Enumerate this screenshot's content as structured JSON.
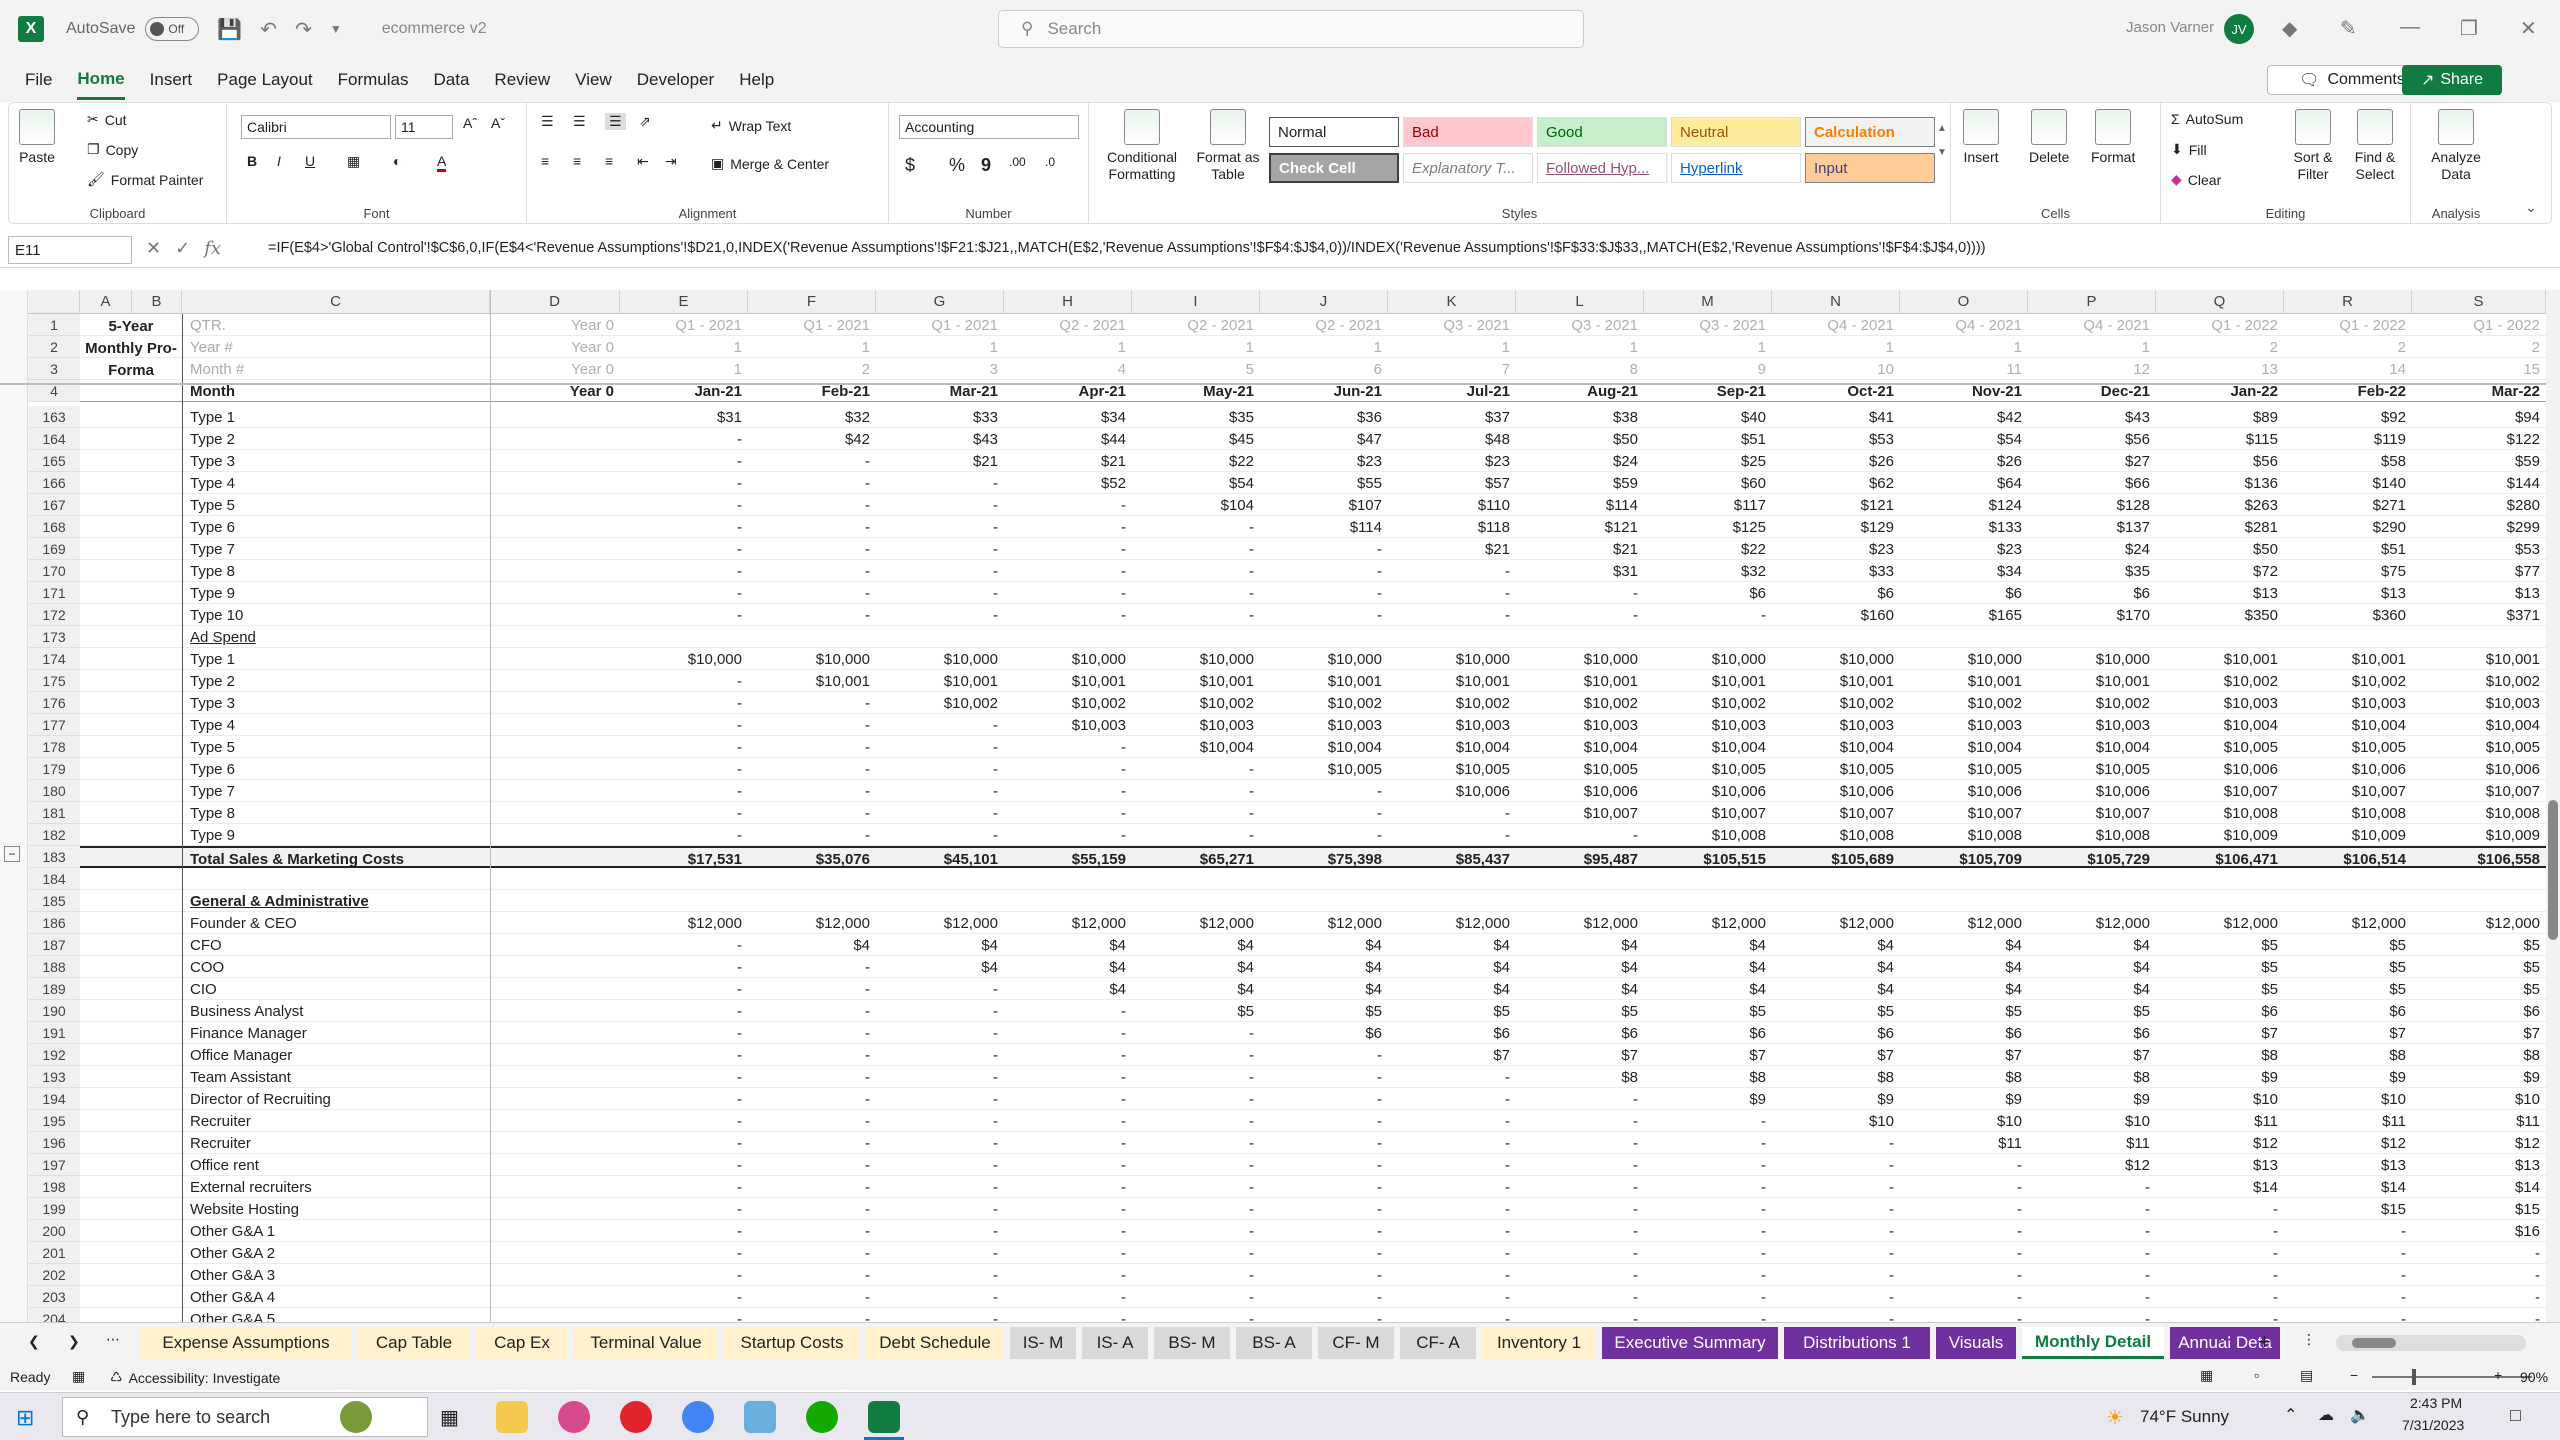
{
  "titlebar": {
    "autosave": "AutoSave",
    "toggle": "Off",
    "doc": "ecommerce v2",
    "search": "Search",
    "user": "Jason Varner",
    "initials": "JV"
  },
  "menu": [
    "File",
    "Home",
    "Insert",
    "Page Layout",
    "Formulas",
    "Data",
    "Review",
    "View",
    "Developer",
    "Help"
  ],
  "menu_active": "Home",
  "buttons": {
    "comments": "Comments",
    "share": "Share"
  },
  "ribbon": {
    "clipboard": {
      "label": "Clipboard",
      "paste": "Paste",
      "cut": "Cut",
      "copy": "Copy",
      "format_painter": "Format Painter"
    },
    "font": {
      "label": "Font",
      "name": "Calibri",
      "size": "11"
    },
    "alignment": {
      "label": "Alignment",
      "wrap": "Wrap Text",
      "merge": "Merge & Center"
    },
    "number": {
      "label": "Number",
      "format": "Accounting",
      "currency": "$",
      "percent": "%",
      "comma": "9"
    },
    "styles": {
      "label": "Styles",
      "conditional": "Conditional Formatting",
      "format_table": "Format as Table",
      "normal": "Normal",
      "bad": "Bad",
      "good": "Good",
      "neutral": "Neutral",
      "calculation": "Calculation",
      "check_cell": "Check Cell",
      "explanatory": "Explanatory T...",
      "followed": "Followed Hyp...",
      "hyperlink": "Hyperlink",
      "input": "Input"
    },
    "cells": {
      "label": "Cells",
      "insert": "Insert",
      "delete": "Delete",
      "format": "Format"
    },
    "editing": {
      "label": "Editing",
      "autosum": "AutoSum",
      "fill": "Fill",
      "clear": "Clear",
      "sort": "Sort & Filter",
      "find": "Find & Select"
    },
    "analysis": {
      "label": "Analysis",
      "analyze": "Analyze Data"
    }
  },
  "namebox": "E11",
  "formula": "=IF(E$4>'Global Control'!$C$6,0,IF(E$4<'Revenue Assumptions'!$D21,0,INDEX('Revenue Assumptions'!$F21:$J21,,MATCH(E$2,'Revenue Assumptions'!$F$4:$J$4,0))/INDEX('Revenue Assumptions'!$F$33:$J$33,,MATCH(E$2,'Revenue Assumptions'!$F$4:$J$4,0))))",
  "columns": [
    "A",
    "B",
    "C",
    "D",
    "E",
    "F",
    "G",
    "H",
    "I",
    "J",
    "K",
    "L",
    "M",
    "N",
    "O",
    "P",
    "Q",
    "R",
    "S"
  ],
  "side_title": [
    "5-Year",
    "Monthly Pro-",
    "Forma"
  ],
  "header_rows": [
    {
      "row": "1",
      "label": "QTR.",
      "d": "Year 0",
      "vals": [
        "Q1 - 2021",
        "Q1 - 2021",
        "Q1 - 2021",
        "Q2 - 2021",
        "Q2 - 2021",
        "Q2 - 2021",
        "Q3 - 2021",
        "Q3 - 2021",
        "Q3 - 2021",
        "Q4 - 2021",
        "Q4 - 2021",
        "Q4 - 2021",
        "Q1 - 2022",
        "Q1 - 2022",
        "Q1 - 2022"
      ]
    },
    {
      "row": "2",
      "label": "Year #",
      "d": "Year 0",
      "vals": [
        "1",
        "1",
        "1",
        "1",
        "1",
        "1",
        "1",
        "1",
        "1",
        "1",
        "1",
        "1",
        "2",
        "2",
        "2"
      ]
    },
    {
      "row": "3",
      "label": "Month #",
      "d": "Year 0",
      "vals": [
        "1",
        "2",
        "3",
        "4",
        "5",
        "6",
        "7",
        "8",
        "9",
        "10",
        "11",
        "12",
        "13",
        "14",
        "15"
      ]
    },
    {
      "row": "4",
      "label": "Month",
      "d": "Year 0",
      "vals": [
        "Jan-21",
        "Feb-21",
        "Mar-21",
        "Apr-21",
        "May-21",
        "Jun-21",
        "Jul-21",
        "Aug-21",
        "Sep-21",
        "Oct-21",
        "Nov-21",
        "Dec-21",
        "Jan-22",
        "Feb-22",
        "Mar-22"
      ]
    }
  ],
  "rows": [
    {
      "row": "163",
      "label": "Type 1",
      "vals": [
        "$31",
        "$32",
        "$33",
        "$34",
        "$35",
        "$36",
        "$37",
        "$38",
        "$40",
        "$41",
        "$42",
        "$43",
        "$89",
        "$92",
        "$94"
      ]
    },
    {
      "row": "164",
      "label": "Type 2",
      "vals": [
        "-",
        "$42",
        "$43",
        "$44",
        "$45",
        "$47",
        "$48",
        "$50",
        "$51",
        "$53",
        "$54",
        "$56",
        "$115",
        "$119",
        "$122"
      ]
    },
    {
      "row": "165",
      "label": "Type 3",
      "vals": [
        "-",
        "-",
        "$21",
        "$21",
        "$22",
        "$23",
        "$23",
        "$24",
        "$25",
        "$26",
        "$26",
        "$27",
        "$56",
        "$58",
        "$59"
      ]
    },
    {
      "row": "166",
      "label": "Type 4",
      "vals": [
        "-",
        "-",
        "-",
        "$52",
        "$54",
        "$55",
        "$57",
        "$59",
        "$60",
        "$62",
        "$64",
        "$66",
        "$136",
        "$140",
        "$144"
      ]
    },
    {
      "row": "167",
      "label": "Type 5",
      "vals": [
        "-",
        "-",
        "-",
        "-",
        "$104",
        "$107",
        "$110",
        "$114",
        "$117",
        "$121",
        "$124",
        "$128",
        "$263",
        "$271",
        "$280"
      ]
    },
    {
      "row": "168",
      "label": "Type 6",
      "vals": [
        "-",
        "-",
        "-",
        "-",
        "-",
        "$114",
        "$118",
        "$121",
        "$125",
        "$129",
        "$133",
        "$137",
        "$281",
        "$290",
        "$299"
      ]
    },
    {
      "row": "169",
      "label": "Type 7",
      "vals": [
        "-",
        "-",
        "-",
        "-",
        "-",
        "-",
        "$21",
        "$21",
        "$22",
        "$23",
        "$23",
        "$24",
        "$50",
        "$51",
        "$53"
      ]
    },
    {
      "row": "170",
      "label": "Type 8",
      "vals": [
        "-",
        "-",
        "-",
        "-",
        "-",
        "-",
        "-",
        "$31",
        "$32",
        "$33",
        "$34",
        "$35",
        "$72",
        "$75",
        "$77"
      ]
    },
    {
      "row": "171",
      "label": "Type 9",
      "vals": [
        "-",
        "-",
        "-",
        "-",
        "-",
        "-",
        "-",
        "-",
        "$6",
        "$6",
        "$6",
        "$6",
        "$13",
        "$13",
        "$13"
      ]
    },
    {
      "row": "172",
      "label": "Type 10",
      "vals": [
        "-",
        "-",
        "-",
        "-",
        "-",
        "-",
        "-",
        "-",
        "-",
        "$160",
        "$165",
        "$170",
        "$350",
        "$360",
        "$371"
      ]
    },
    {
      "row": "173",
      "label": "Ad Spend",
      "style": "ulp",
      "vals": [
        "",
        "",
        "",
        "",
        "",
        "",
        "",
        "",
        "",
        "",
        "",
        "",
        "",
        "",
        ""
      ]
    },
    {
      "row": "174",
      "label": "Type 1",
      "vals": [
        "$10,000",
        "$10,000",
        "$10,000",
        "$10,000",
        "$10,000",
        "$10,000",
        "$10,000",
        "$10,000",
        "$10,000",
        "$10,000",
        "$10,000",
        "$10,000",
        "$10,001",
        "$10,001",
        "$10,001"
      ]
    },
    {
      "row": "175",
      "label": "Type 2",
      "vals": [
        "-",
        "$10,001",
        "$10,001",
        "$10,001",
        "$10,001",
        "$10,001",
        "$10,001",
        "$10,001",
        "$10,001",
        "$10,001",
        "$10,001",
        "$10,001",
        "$10,002",
        "$10,002",
        "$10,002"
      ]
    },
    {
      "row": "176",
      "label": "Type 3",
      "vals": [
        "-",
        "-",
        "$10,002",
        "$10,002",
        "$10,002",
        "$10,002",
        "$10,002",
        "$10,002",
        "$10,002",
        "$10,002",
        "$10,002",
        "$10,002",
        "$10,003",
        "$10,003",
        "$10,003"
      ]
    },
    {
      "row": "177",
      "label": "Type 4",
      "vals": [
        "-",
        "-",
        "-",
        "$10,003",
        "$10,003",
        "$10,003",
        "$10,003",
        "$10,003",
        "$10,003",
        "$10,003",
        "$10,003",
        "$10,003",
        "$10,004",
        "$10,004",
        "$10,004"
      ]
    },
    {
      "row": "178",
      "label": "Type 5",
      "vals": [
        "-",
        "-",
        "-",
        "-",
        "$10,004",
        "$10,004",
        "$10,004",
        "$10,004",
        "$10,004",
        "$10,004",
        "$10,004",
        "$10,004",
        "$10,005",
        "$10,005",
        "$10,005"
      ]
    },
    {
      "row": "179",
      "label": "Type 6",
      "vals": [
        "-",
        "-",
        "-",
        "-",
        "-",
        "$10,005",
        "$10,005",
        "$10,005",
        "$10,005",
        "$10,005",
        "$10,005",
        "$10,005",
        "$10,006",
        "$10,006",
        "$10,006"
      ]
    },
    {
      "row": "180",
      "label": "Type 7",
      "vals": [
        "-",
        "-",
        "-",
        "-",
        "-",
        "-",
        "$10,006",
        "$10,006",
        "$10,006",
        "$10,006",
        "$10,006",
        "$10,006",
        "$10,007",
        "$10,007",
        "$10,007"
      ]
    },
    {
      "row": "181",
      "label": "Type 8",
      "vals": [
        "-",
        "-",
        "-",
        "-",
        "-",
        "-",
        "-",
        "$10,007",
        "$10,007",
        "$10,007",
        "$10,007",
        "$10,007",
        "$10,008",
        "$10,008",
        "$10,008"
      ]
    },
    {
      "row": "182",
      "label": "Type 9",
      "vals": [
        "-",
        "-",
        "-",
        "-",
        "-",
        "-",
        "-",
        "-",
        "$10,008",
        "$10,008",
        "$10,008",
        "$10,008",
        "$10,009",
        "$10,009",
        "$10,009"
      ]
    },
    {
      "row": "183",
      "label": "Total Sales & Marketing Costs",
      "style": "total",
      "vals": [
        "$17,531",
        "$35,076",
        "$45,101",
        "$55,159",
        "$65,271",
        "$75,398",
        "$85,437",
        "$95,487",
        "$105,515",
        "$105,689",
        "$105,709",
        "$105,729",
        "$106,471",
        "$106,514",
        "$106,558"
      ]
    },
    {
      "row": "184",
      "label": "",
      "vals": [
        "",
        "",
        "",
        "",
        "",
        "",
        "",
        "",
        "",
        "",
        "",
        "",
        "",
        "",
        ""
      ]
    },
    {
      "row": "185",
      "label": "General & Administrative",
      "style": "ul",
      "vals": [
        "",
        "",
        "",
        "",
        "",
        "",
        "",
        "",
        "",
        "",
        "",
        "",
        "",
        "",
        ""
      ]
    },
    {
      "row": "186",
      "label": "Founder & CEO",
      "vals": [
        "$12,000",
        "$12,000",
        "$12,000",
        "$12,000",
        "$12,000",
        "$12,000",
        "$12,000",
        "$12,000",
        "$12,000",
        "$12,000",
        "$12,000",
        "$12,000",
        "$12,000",
        "$12,000",
        "$12,000"
      ]
    },
    {
      "row": "187",
      "label": "CFO",
      "vals": [
        "-",
        "$4",
        "$4",
        "$4",
        "$4",
        "$4",
        "$4",
        "$4",
        "$4",
        "$4",
        "$4",
        "$4",
        "$5",
        "$5",
        "$5"
      ]
    },
    {
      "row": "188",
      "label": "COO",
      "vals": [
        "-",
        "-",
        "$4",
        "$4",
        "$4",
        "$4",
        "$4",
        "$4",
        "$4",
        "$4",
        "$4",
        "$4",
        "$5",
        "$5",
        "$5"
      ]
    },
    {
      "row": "189",
      "label": "CIO",
      "vals": [
        "-",
        "-",
        "-",
        "$4",
        "$4",
        "$4",
        "$4",
        "$4",
        "$4",
        "$4",
        "$4",
        "$4",
        "$5",
        "$5",
        "$5"
      ]
    },
    {
      "row": "190",
      "label": "Business Analyst",
      "vals": [
        "-",
        "-",
        "-",
        "-",
        "$5",
        "$5",
        "$5",
        "$5",
        "$5",
        "$5",
        "$5",
        "$5",
        "$6",
        "$6",
        "$6"
      ]
    },
    {
      "row": "191",
      "label": "Finance Manager",
      "vals": [
        "-",
        "-",
        "-",
        "-",
        "-",
        "$6",
        "$6",
        "$6",
        "$6",
        "$6",
        "$6",
        "$6",
        "$7",
        "$7",
        "$7"
      ]
    },
    {
      "row": "192",
      "label": "Office Manager",
      "vals": [
        "-",
        "-",
        "-",
        "-",
        "-",
        "-",
        "$7",
        "$7",
        "$7",
        "$7",
        "$7",
        "$7",
        "$8",
        "$8",
        "$8"
      ]
    },
    {
      "row": "193",
      "label": "Team Assistant",
      "vals": [
        "-",
        "-",
        "-",
        "-",
        "-",
        "-",
        "-",
        "$8",
        "$8",
        "$8",
        "$8",
        "$8",
        "$9",
        "$9",
        "$9"
      ]
    },
    {
      "row": "194",
      "label": "Director of Recruiting",
      "vals": [
        "-",
        "-",
        "-",
        "-",
        "-",
        "-",
        "-",
        "-",
        "$9",
        "$9",
        "$9",
        "$9",
        "$10",
        "$10",
        "$10"
      ]
    },
    {
      "row": "195",
      "label": "Recruiter",
      "vals": [
        "-",
        "-",
        "-",
        "-",
        "-",
        "-",
        "-",
        "-",
        "-",
        "$10",
        "$10",
        "$10",
        "$11",
        "$11",
        "$11"
      ]
    },
    {
      "row": "196",
      "label": "Recruiter",
      "vals": [
        "-",
        "-",
        "-",
        "-",
        "-",
        "-",
        "-",
        "-",
        "-",
        "-",
        "$11",
        "$11",
        "$12",
        "$12",
        "$12"
      ]
    },
    {
      "row": "197",
      "label": "Office rent",
      "vals": [
        "-",
        "-",
        "-",
        "-",
        "-",
        "-",
        "-",
        "-",
        "-",
        "-",
        "-",
        "$12",
        "$13",
        "$13",
        "$13"
      ]
    },
    {
      "row": "198",
      "label": "External recruiters",
      "vals": [
        "-",
        "-",
        "-",
        "-",
        "-",
        "-",
        "-",
        "-",
        "-",
        "-",
        "-",
        "-",
        "$14",
        "$14",
        "$14"
      ]
    },
    {
      "row": "199",
      "label": "Website Hosting",
      "vals": [
        "-",
        "-",
        "-",
        "-",
        "-",
        "-",
        "-",
        "-",
        "-",
        "-",
        "-",
        "-",
        "-",
        "$15",
        "$15"
      ]
    },
    {
      "row": "200",
      "label": "Other G&A 1",
      "vals": [
        "-",
        "-",
        "-",
        "-",
        "-",
        "-",
        "-",
        "-",
        "-",
        "-",
        "-",
        "-",
        "-",
        "-",
        "$16"
      ]
    },
    {
      "row": "201",
      "label": "Other G&A 2",
      "vals": [
        "-",
        "-",
        "-",
        "-",
        "-",
        "-",
        "-",
        "-",
        "-",
        "-",
        "-",
        "-",
        "-",
        "-",
        "-"
      ]
    },
    {
      "row": "202",
      "label": "Other G&A 3",
      "vals": [
        "-",
        "-",
        "-",
        "-",
        "-",
        "-",
        "-",
        "-",
        "-",
        "-",
        "-",
        "-",
        "-",
        "-",
        "-"
      ]
    },
    {
      "row": "203",
      "label": "Other G&A 4",
      "vals": [
        "-",
        "-",
        "-",
        "-",
        "-",
        "-",
        "-",
        "-",
        "-",
        "-",
        "-",
        "-",
        "-",
        "-",
        "-"
      ]
    },
    {
      "row": "204",
      "label": "Other G&A 5",
      "vals": [
        "-",
        "-",
        "-",
        "-",
        "-",
        "-",
        "-",
        "-",
        "-",
        "-",
        "-",
        "-",
        "-",
        "-",
        "-"
      ]
    },
    {
      "row": "205",
      "label": "Other G&A 6",
      "vals": [
        "-",
        "-",
        "-",
        "-",
        "-",
        "-",
        "-",
        "-",
        "-",
        "-",
        "-",
        "-",
        "-",
        "-",
        "-"
      ]
    }
  ],
  "sheet_tabs": [
    {
      "name": "Expense Assumptions",
      "color": "#fff2cc",
      "text": "#222"
    },
    {
      "name": "Cap Table",
      "color": "#fff2cc",
      "text": "#222"
    },
    {
      "name": "Cap Ex",
      "color": "#fff2cc",
      "text": "#222"
    },
    {
      "name": "Terminal Value",
      "color": "#fff2cc",
      "text": "#222"
    },
    {
      "name": "Startup Costs",
      "color": "#fff2cc",
      "text": "#222"
    },
    {
      "name": "Debt Schedule",
      "color": "#fff2cc",
      "text": "#222"
    },
    {
      "name": "IS- M",
      "color": "#d9d9d9",
      "text": "#222"
    },
    {
      "name": "IS- A",
      "color": "#d9d9d9",
      "text": "#222"
    },
    {
      "name": "BS- M",
      "color": "#d9d9d9",
      "text": "#222"
    },
    {
      "name": "BS- A",
      "color": "#d9d9d9",
      "text": "#222"
    },
    {
      "name": "CF- M",
      "color": "#d9d9d9",
      "text": "#222"
    },
    {
      "name": "CF- A",
      "color": "#d9d9d9",
      "text": "#222"
    },
    {
      "name": "Inventory 1",
      "color": "#fff2cc",
      "text": "#222"
    },
    {
      "name": "Executive Summary",
      "color": "#7030a0",
      "text": "#fff"
    },
    {
      "name": "Distributions 1",
      "color": "#7030a0",
      "text": "#fff"
    },
    {
      "name": "Visuals",
      "color": "#7030a0",
      "text": "#fff"
    },
    {
      "name": "Monthly Detail",
      "color": "#ffffff",
      "text": "#222"
    },
    {
      "name": "Annual Deta",
      "color": "#7030a0",
      "text": "#fff"
    }
  ],
  "status": {
    "ready": "Ready",
    "accessibility": "Accessibility: Investigate",
    "zoom": "90%"
  },
  "taskbar": {
    "search": "Type here to search",
    "weather": "74°F  Sunny",
    "time": "2:43 PM",
    "date": "7/31/2023"
  }
}
